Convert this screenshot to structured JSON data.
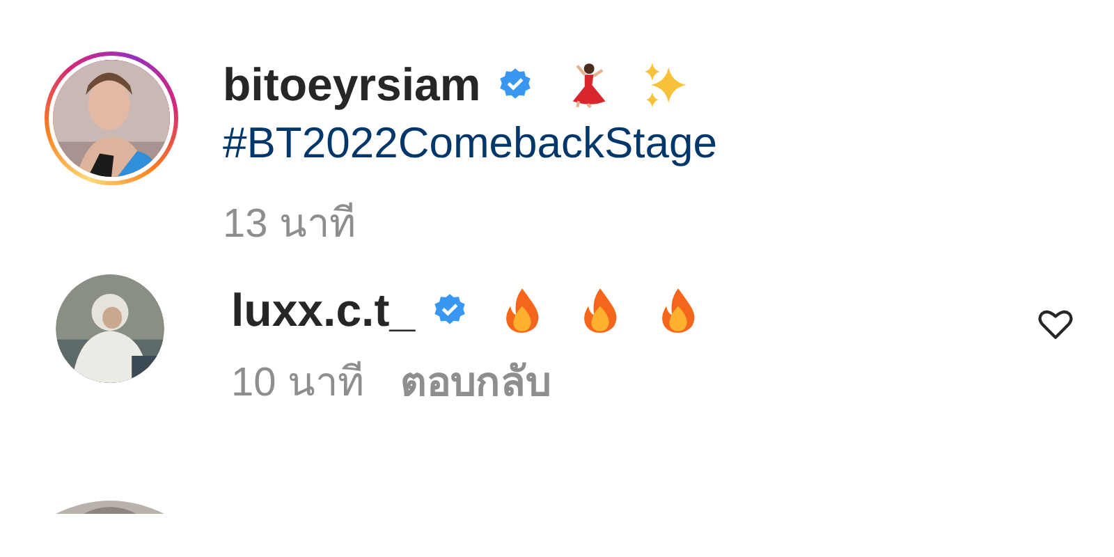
{
  "comments": [
    {
      "username": "bitoeyrsiam",
      "verified": true,
      "story_ring": true,
      "emojis": [
        {
          "kind": "dancer"
        },
        {
          "kind": "sparkles"
        }
      ],
      "text": "#BT2022ComebackStage",
      "time": "13 นาที",
      "like_button": false
    },
    {
      "username": "luxx.c.t_",
      "verified": true,
      "story_ring": false,
      "emojis": [
        {
          "kind": "fire"
        },
        {
          "kind": "fire"
        },
        {
          "kind": "fire"
        }
      ],
      "time": "10 นาที",
      "reply": "ตอบกลับ",
      "like_button": true
    }
  ]
}
